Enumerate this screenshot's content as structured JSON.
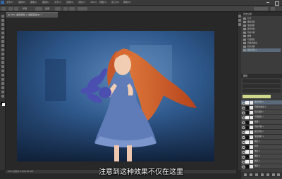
{
  "menubar": {
    "items": [
      "文件(F)",
      "编辑(E)",
      "图像(I)",
      "图层(L)",
      "文字(Y)",
      "选择(S)",
      "滤镜(T)",
      "3D(D)",
      "视图(V)",
      "窗口(W)",
      "帮助(H)"
    ]
  },
  "options": {
    "mode_label": "标准",
    "field_text": "宽度"
  },
  "document": {
    "tab_title": "@ 50% (颜色查找 2, 图层蒙版/8) *",
    "status_text": "50%   文档:13.1M/161.9M"
  },
  "subtitle": "注意到这种效果不仅在这里",
  "history": {
    "title": "历史记录",
    "items": [
      "打开",
      "图层蒙版",
      "渐变映射",
      "颜色查找",
      "色彩平衡",
      "曲线",
      "可选颜色",
      "色相/饱和度",
      "照片滤镜",
      "颜色查找 2"
    ]
  },
  "layers": {
    "title": "图层",
    "items": [
      {
        "name": "颜色查找 2",
        "thumb": "light"
      },
      {
        "name": "色相/饱和度 1",
        "thumb": "dark"
      },
      {
        "name": "照片滤镜 1",
        "thumb": "dark"
      },
      {
        "name": "可选颜色 1",
        "thumb": "light"
      },
      {
        "name": "曲线 1",
        "thumb": "dark"
      },
      {
        "name": "色彩平衡 1",
        "thumb": "dark"
      },
      {
        "name": "颜色查找 1",
        "thumb": "light"
      },
      {
        "name": "渐变映射 1",
        "thumb": "dark"
      },
      {
        "name": "图层 1",
        "thumb": "light"
      },
      {
        "name": "背景",
        "thumb": "dark"
      },
      {
        "name": "图层 2",
        "thumb": "light"
      },
      {
        "name": "图层 3",
        "thumb": "dark"
      },
      {
        "name": "图层 4",
        "thumb": "light"
      },
      {
        "name": "图层 5",
        "thumb": "dark"
      }
    ]
  },
  "colors": {
    "photo_blue": "#2f5a8e",
    "hair": "#c7582a",
    "dress": "#5f7cb8",
    "flowers": "#4b4fb0",
    "selection_tag": "#cfd88a"
  }
}
